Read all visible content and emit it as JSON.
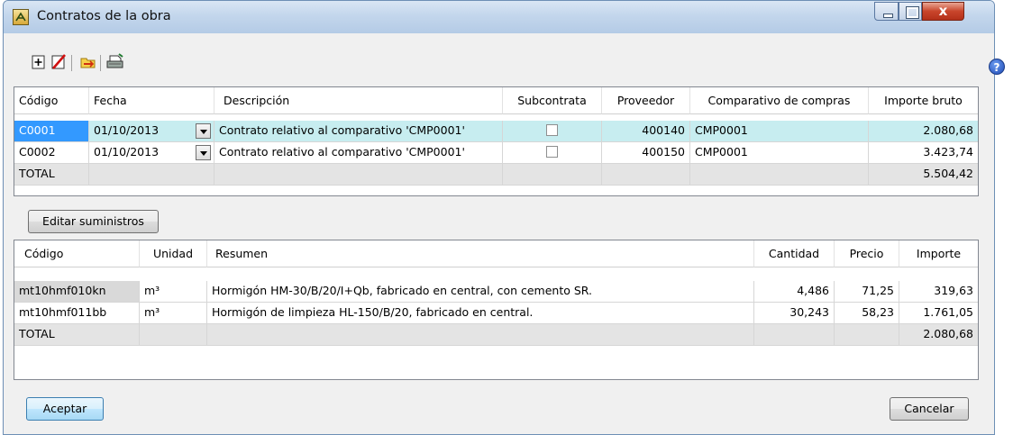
{
  "window": {
    "title": "Contratos de la obra",
    "close_glyph": "x"
  },
  "toolbar": {
    "icons": [
      "add-row-icon",
      "delete-row-icon",
      "open-folder-icon",
      "print-icon"
    ]
  },
  "help_glyph": "?",
  "contracts": {
    "headers": {
      "code": "Código",
      "date": "Fecha",
      "description": "Descripción",
      "subcontract": "Subcontrata",
      "supplier": "Proveedor",
      "comparative": "Comparativo de compras",
      "gross": "Importe bruto"
    },
    "rows": [
      {
        "code": "C0001",
        "date": "01/10/2013",
        "description": "Contrato relativo al comparativo 'CMP0001'",
        "subcontract": false,
        "supplier": "400140",
        "comparative": "CMP0001",
        "gross": "2.080,68"
      },
      {
        "code": "C0002",
        "date": "01/10/2013",
        "description": "Contrato relativo al comparativo 'CMP0001'",
        "subcontract": false,
        "supplier": "400150",
        "comparative": "CMP0001",
        "gross": "3.423,74"
      }
    ],
    "total_label": "TOTAL",
    "total_value": "5.504,42"
  },
  "edit_supplies_label": "Editar suministros",
  "supplies": {
    "headers": {
      "code": "Código",
      "unit": "Unidad",
      "summary": "Resumen",
      "quantity": "Cantidad",
      "price": "Precio",
      "amount": "Importe"
    },
    "rows": [
      {
        "code": "mt10hmf010kn",
        "unit": "m³",
        "summary": "Hormigón HM-30/B/20/I+Qb, fabricado en central, con cemento SR.",
        "quantity": "4,486",
        "price": "71,25",
        "amount": "319,63"
      },
      {
        "code": "mt10hmf011bb",
        "unit": "m³",
        "summary": "Hormigón de limpieza HL-150/B/20, fabricado en central.",
        "quantity": "30,243",
        "price": "58,23",
        "amount": "1.761,05"
      }
    ],
    "total_label": "TOTAL",
    "total_value": "2.080,68"
  },
  "buttons": {
    "accept": "Aceptar",
    "cancel": "Cancelar"
  },
  "colors": {
    "selected_row": "#c7edf0",
    "selected_cell": "#3399ff",
    "total_row": "#e4e4e4"
  }
}
